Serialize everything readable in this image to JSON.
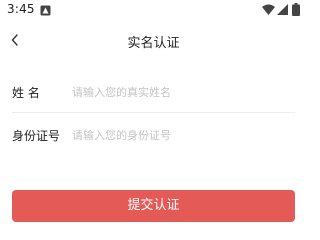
{
  "status_bar": {
    "time": "3:45",
    "icons": [
      "notification-icon",
      "wifi-icon",
      "cell-signal-icon",
      "battery-icon"
    ]
  },
  "header": {
    "back_icon": "chevron-left-icon",
    "title": "实名认证"
  },
  "form": {
    "name": {
      "label": "姓 名",
      "placeholder": "请输入您的真实姓名",
      "value": ""
    },
    "id_number": {
      "label": "身份证号",
      "placeholder": "请输入您的身份证号",
      "value": ""
    }
  },
  "submit_label": "提交认证",
  "colors": {
    "accent": "#e35a57",
    "divider": "#eeeeee",
    "placeholder": "#c4c4c4",
    "text": "#222222"
  }
}
